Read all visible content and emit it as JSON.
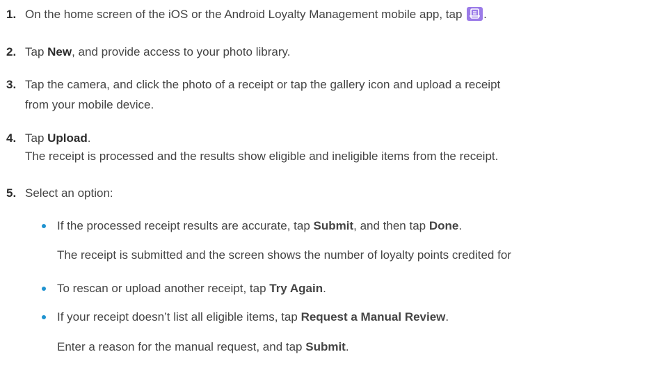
{
  "steps": [
    {
      "num": "1.",
      "pre": "On the home screen of the iOS or the Android Loyalty Management mobile app, tap ",
      "post": "."
    },
    {
      "num": "2.",
      "pre": "Tap ",
      "bold": "New",
      "post": ", and provide access to your photo library."
    },
    {
      "num": "3.",
      "line1": "Tap the camera, and click the photo of a receipt or tap the gallery icon and upload a receipt",
      "line2": "from your mobile device."
    },
    {
      "num": "4.",
      "pre": "Tap ",
      "bold": "Upload",
      "post": ".",
      "result": "The receipt is processed and the results show eligible and ineligible items from the receipt."
    },
    {
      "num": "5.",
      "text": "Select an option:"
    }
  ],
  "options": [
    {
      "pre": "If the processed receipt results are accurate, tap ",
      "bold1": "Submit",
      "mid": ", and then tap ",
      "bold2": "Done",
      "post": ".",
      "result": "The receipt is submitted and the screen shows the number of loyalty points credited for"
    },
    {
      "pre": "To rescan or upload another receipt, tap ",
      "bold": "Try Again",
      "post": "."
    },
    {
      "pre": "If your receipt doesn’t list all eligible items, tap ",
      "bold": "Request a Manual Review",
      "post": ".",
      "result_pre": "Enter a reason for the manual request, and tap ",
      "result_bold": "Submit",
      "result_post": "."
    }
  ],
  "colors": {
    "bullet": "#1f93d0",
    "app_icon": "#9b7be8"
  },
  "icons": {
    "app_icon": "receipt-scan-icon"
  }
}
